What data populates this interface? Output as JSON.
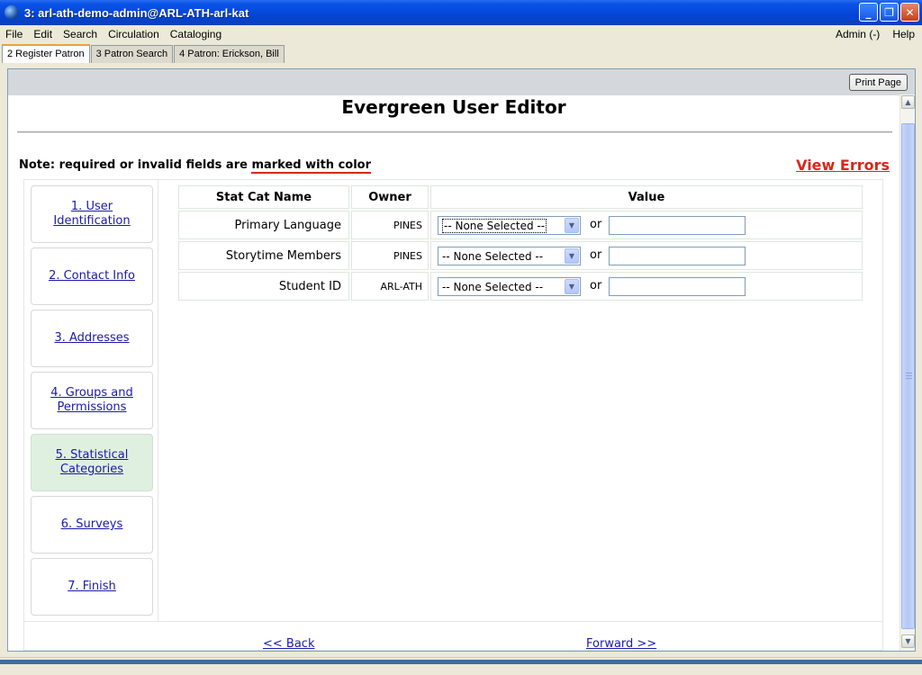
{
  "window": {
    "title": "3: arl-ath-demo-admin@ARL-ATH-arl-kat",
    "minimize": "_",
    "restore": "❐",
    "close": "✕"
  },
  "menubar": {
    "items": [
      "File",
      "Edit",
      "Search",
      "Circulation",
      "Cataloging"
    ],
    "right": [
      "Admin (-)",
      "Help"
    ]
  },
  "tabs": [
    {
      "label": "2 Register Patron",
      "active": true
    },
    {
      "label": "3 Patron Search",
      "active": false
    },
    {
      "label": "4 Patron: Erickson, Bill",
      "active": false
    }
  ],
  "toolbar": {
    "print_label": "Print Page"
  },
  "page": {
    "title": "Evergreen User Editor",
    "note_prefix": "Note: required or invalid fields are ",
    "note_marked": "marked with color",
    "view_errors": "View Errors"
  },
  "steps": [
    {
      "label": "1. User Identification"
    },
    {
      "label": "2. Contact Info"
    },
    {
      "label": "3. Addresses"
    },
    {
      "label": "4. Groups and Permissions"
    },
    {
      "label": "5. Statistical Categories"
    },
    {
      "label": "6. Surveys"
    },
    {
      "label": "7. Finish"
    }
  ],
  "stat_table": {
    "headers": [
      "Stat Cat Name",
      "Owner",
      "Value"
    ],
    "rows": [
      {
        "name": "Primary Language",
        "owner": "PINES",
        "select": "-- None Selected --",
        "or": "or",
        "value": ""
      },
      {
        "name": "Storytime Members",
        "owner": "PINES",
        "select": "-- None Selected --",
        "or": "or",
        "value": ""
      },
      {
        "name": "Student ID",
        "owner": "ARL-ATH",
        "select": "-- None Selected --",
        "or": "or",
        "value": ""
      }
    ]
  },
  "nav": {
    "back": "<< Back",
    "forward": "Forward >>"
  }
}
